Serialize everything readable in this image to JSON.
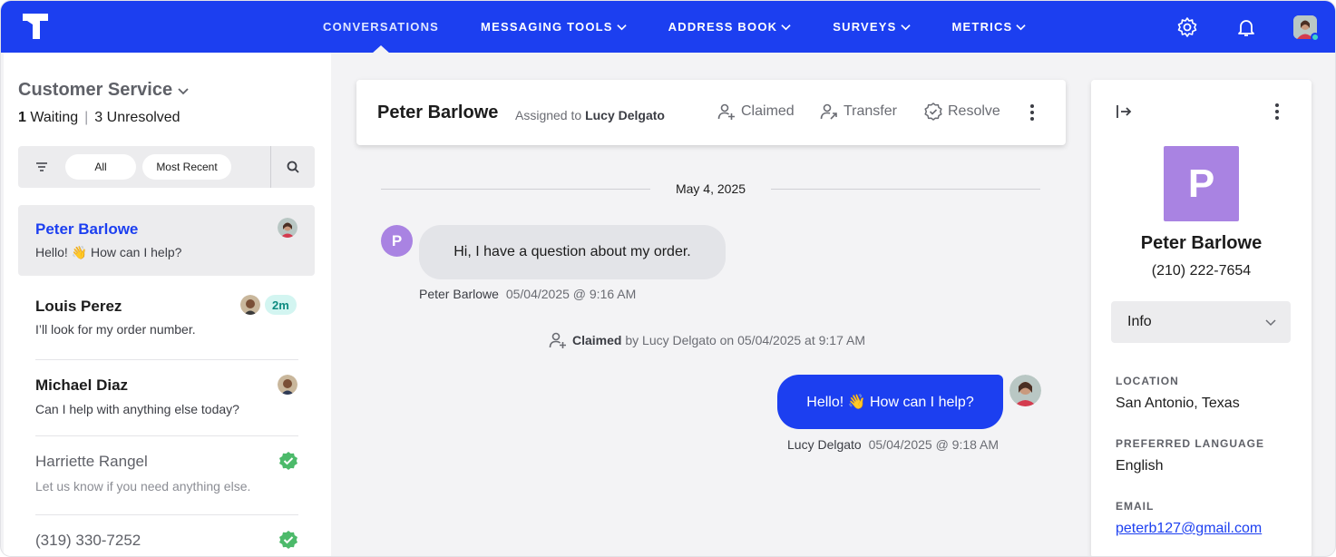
{
  "nav": {
    "items": [
      {
        "label": "CONVERSATIONS",
        "active": true,
        "dropdown": false
      },
      {
        "label": "MESSAGING TOOLS",
        "active": false,
        "dropdown": true
      },
      {
        "label": "ADDRESS BOOK",
        "active": false,
        "dropdown": true
      },
      {
        "label": "SURVEYS",
        "active": false,
        "dropdown": true
      },
      {
        "label": "METRICS",
        "active": false,
        "dropdown": true
      }
    ],
    "icons": [
      "settings-icon",
      "notification-bell-icon",
      "user-avatar"
    ],
    "brand_color": "#1c3ff0"
  },
  "queue": {
    "title": "Customer Service",
    "waiting_count": "1",
    "waiting_label": "Waiting",
    "unresolved_count": "3",
    "unresolved_label": "Unresolved",
    "filters": {
      "all_label": "All",
      "sort_label": "Most Recent"
    }
  },
  "conversations": [
    {
      "name": "Peter Barlowe",
      "preview": "Hello! 👋 How can I help?",
      "selected": true,
      "status": "avatar"
    },
    {
      "name": "Louis Perez",
      "preview": "I’ll look for my order number.",
      "selected": false,
      "status": "waiting",
      "badge": "2m"
    },
    {
      "name": "Michael Diaz",
      "preview": "Can I help with anything else today?",
      "selected": false,
      "status": "avatar"
    },
    {
      "name": "Harriette Rangel",
      "preview": "Let us know if you need anything else.",
      "selected": false,
      "status": "resolved"
    },
    {
      "name": "(319) 330-7252",
      "preview": "",
      "selected": false,
      "status": "resolved"
    }
  ],
  "header": {
    "name": "Peter Barlowe",
    "assigned_prefix": "Assigned to",
    "assigned_to": "Lucy Delgato",
    "actions": {
      "claimed": "Claimed",
      "transfer": "Transfer",
      "resolve": "Resolve"
    }
  },
  "thread": {
    "date": "May 4, 2025",
    "incoming": {
      "avatar_letter": "P",
      "text": "Hi, I have a question about my order.",
      "sender": "Peter Barlowe",
      "time": "05/04/2025 @ 9:16 AM"
    },
    "event": {
      "action": "Claimed",
      "text": "by Lucy Delgato on 05/04/2025 at 9:17 AM"
    },
    "outgoing": {
      "text": "Hello! 👋 How can I help?",
      "sender": "Lucy Delgato",
      "time": "05/04/2025 @ 9:18 AM"
    }
  },
  "contact": {
    "avatar_letter": "P",
    "name": "Peter Barlowe",
    "phone": "(210) 222-7654",
    "section": "Info",
    "fields": {
      "location_label": "LOCATION",
      "location": "San Antonio, Texas",
      "language_label": "PREFERRED LANGUAGE",
      "language": "English",
      "email_label": "EMAIL",
      "email": "peterb127@gmail.com"
    }
  }
}
